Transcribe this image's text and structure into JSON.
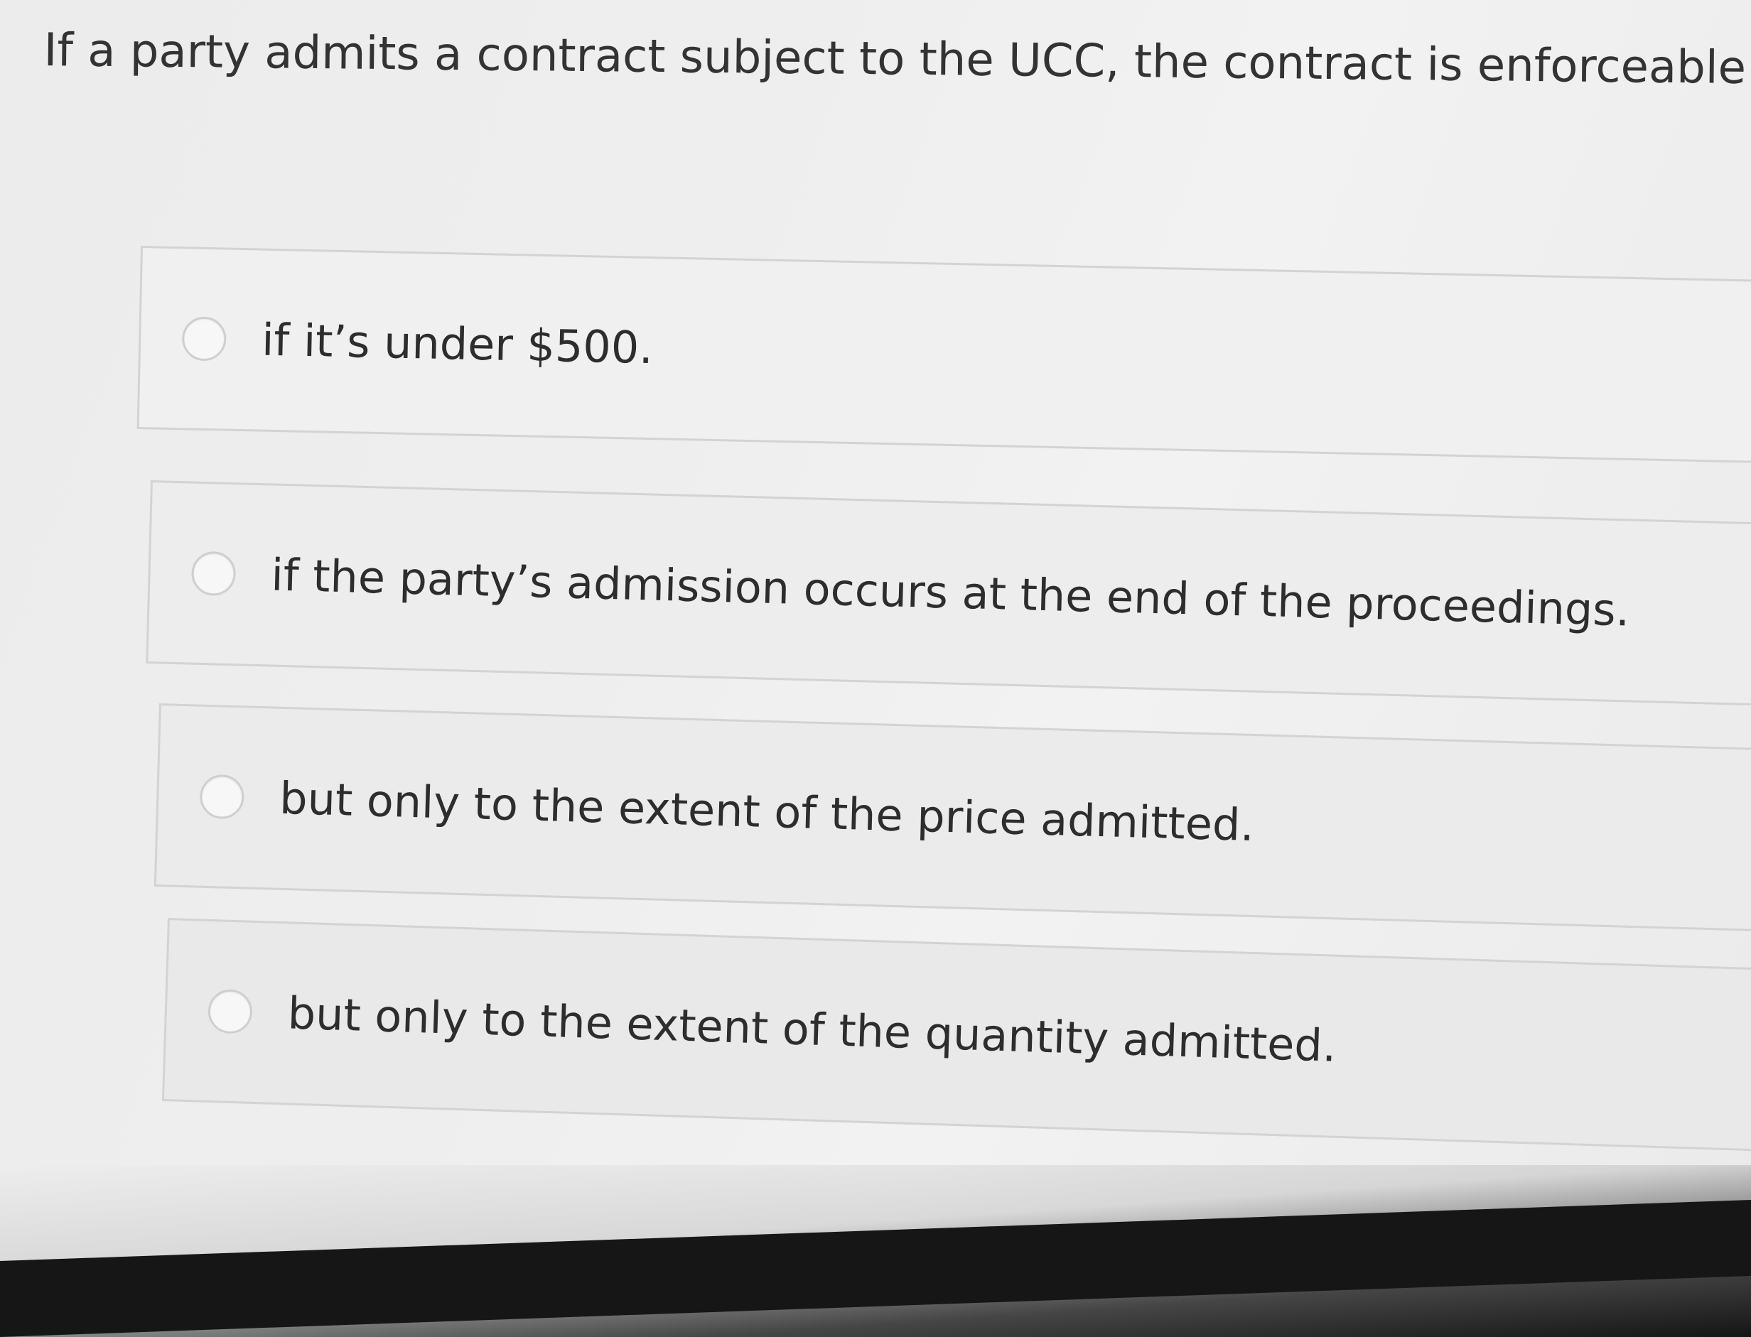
{
  "question": {
    "text": "If a party admits a contract subject to the UCC, the contract is enforceable"
  },
  "options": [
    {
      "label": "if it’s under $500."
    },
    {
      "label": "if the party’s admission occurs at the end of the proceedings."
    },
    {
      "label": "but only to the extent of the price admitted."
    },
    {
      "label": "but only to the extent of the quantity admitted."
    }
  ]
}
